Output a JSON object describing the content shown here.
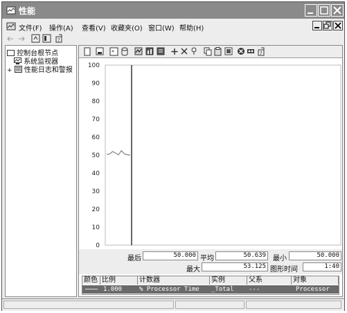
{
  "window": {
    "title": "性能"
  },
  "menu": {
    "items": [
      {
        "label": "文件(F)"
      },
      {
        "label": "操作(A)"
      },
      {
        "label": "查看(V)"
      },
      {
        "label": "收藏夹(O)"
      },
      {
        "label": "窗口(W)"
      },
      {
        "label": "帮助(H)"
      }
    ]
  },
  "tree": {
    "root": "控制台根节点",
    "child1": "系统监视器",
    "child2": "性能日志和警报",
    "expander": "+"
  },
  "chart_data": {
    "type": "line",
    "ylim": [
      0,
      100
    ],
    "yticks": [
      "100",
      "90",
      "80",
      "70",
      "60",
      "50",
      "40",
      "30",
      "20",
      "10",
      "0"
    ],
    "series": [
      {
        "values": [
          50.4,
          50.6,
          52.0,
          51.2,
          50.1,
          52.5,
          50.7,
          50.2,
          50.0
        ]
      }
    ]
  },
  "stats": {
    "last_label": "最后",
    "last_value": "50.000",
    "avg_label": "平均",
    "avg_value": "50.639",
    "min_label": "最小",
    "min_value": "50.000",
    "max_label": "最大",
    "max_value": "53.125",
    "duration_label": "图形时间",
    "duration_value": "1:40"
  },
  "legend": {
    "headers": [
      "颜色",
      "比例",
      "计数器",
      "实例",
      "父系",
      "对象"
    ],
    "row": {
      "scale": "1.000",
      "counter": "% Processor Time",
      "instance": "_Total",
      "parent": "---",
      "object": "Processor"
    }
  }
}
